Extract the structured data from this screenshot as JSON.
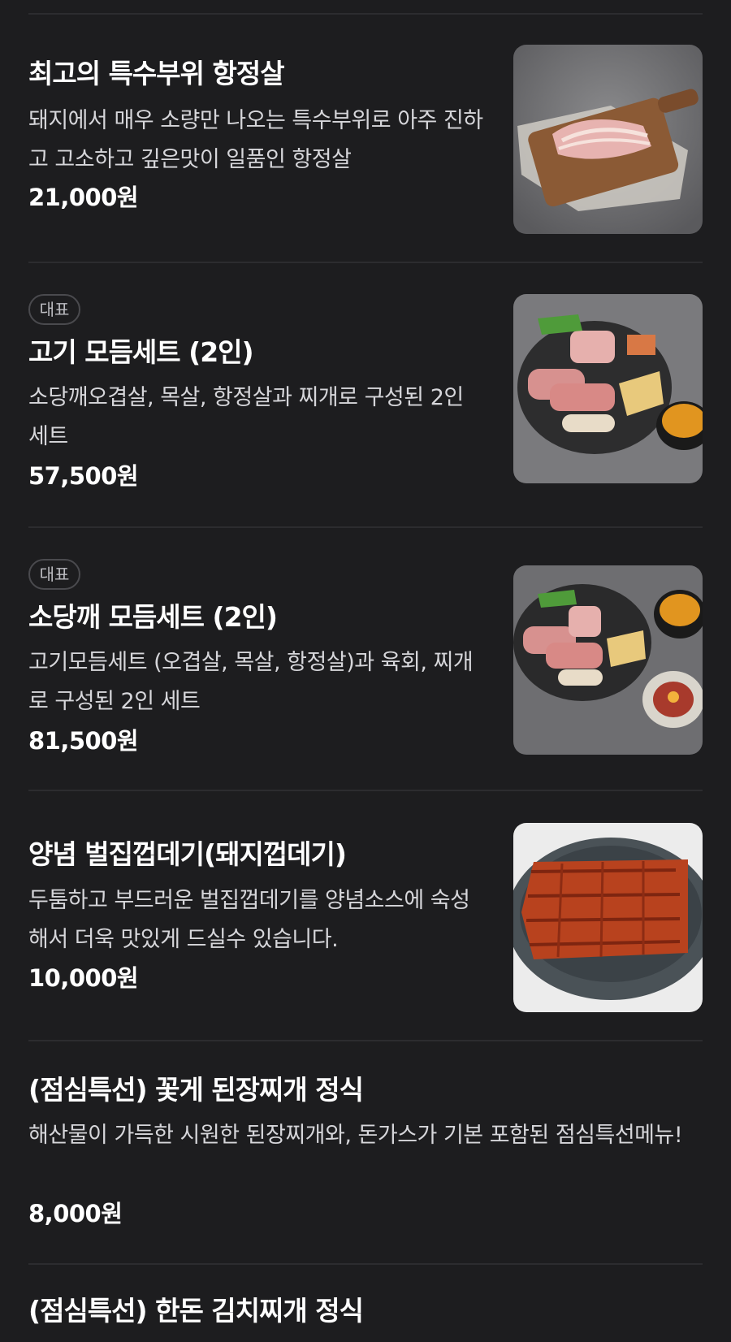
{
  "menu": {
    "items": [
      {
        "title": "최고의 특수부위 항정살",
        "description": "돼지에서 매우 소량만 나오는 특수부위로 아주 진하고 고소하고 깊은맛이 일품인 항정살",
        "price": "21,000원",
        "image_icon": "pork-jowl-on-board-photo"
      },
      {
        "badge": "대표",
        "title": "고기 모듬세트 (2인)",
        "description": "소당깨오겹살, 목살, 항정살과 찌개로 구성된 2인 세트",
        "price": "57,500원",
        "image_icon": "meat-platter-with-stew-photo"
      },
      {
        "badge": "대표",
        "title": "소당깨 모듬세트 (2인)",
        "description": "고기모듬세트 (오겹살, 목살, 항정살)과 육회, 찌개로 구성된 2인 세트",
        "price": "81,500원",
        "image_icon": "meat-platter-with-yukhoe-photo"
      },
      {
        "title": "양념 벌집껍데기(돼지껍데기)",
        "description": "두툼하고 부드러운 벌집껍데기를 양념소스에 숙성해서 더욱 맛있게 드실수 있습니다.",
        "price": "10,000원",
        "image_icon": "seasoned-pork-skin-plate-photo"
      },
      {
        "title": "(점심특선) 꽃게 된장찌개 정식",
        "description": "해산물이 가득한 시원한 된장찌개와, 돈가스가 기본 포함된 점심특선메뉴!",
        "price": "8,000원"
      },
      {
        "title": "(점심특선) 한돈 김치찌개 정식"
      }
    ]
  },
  "colors": {
    "background": "#1d1d1f",
    "divider": "#2c2c2f",
    "text_primary": "#ffffff",
    "text_secondary": "#d6d6da",
    "badge_border": "#4a4a4e"
  }
}
